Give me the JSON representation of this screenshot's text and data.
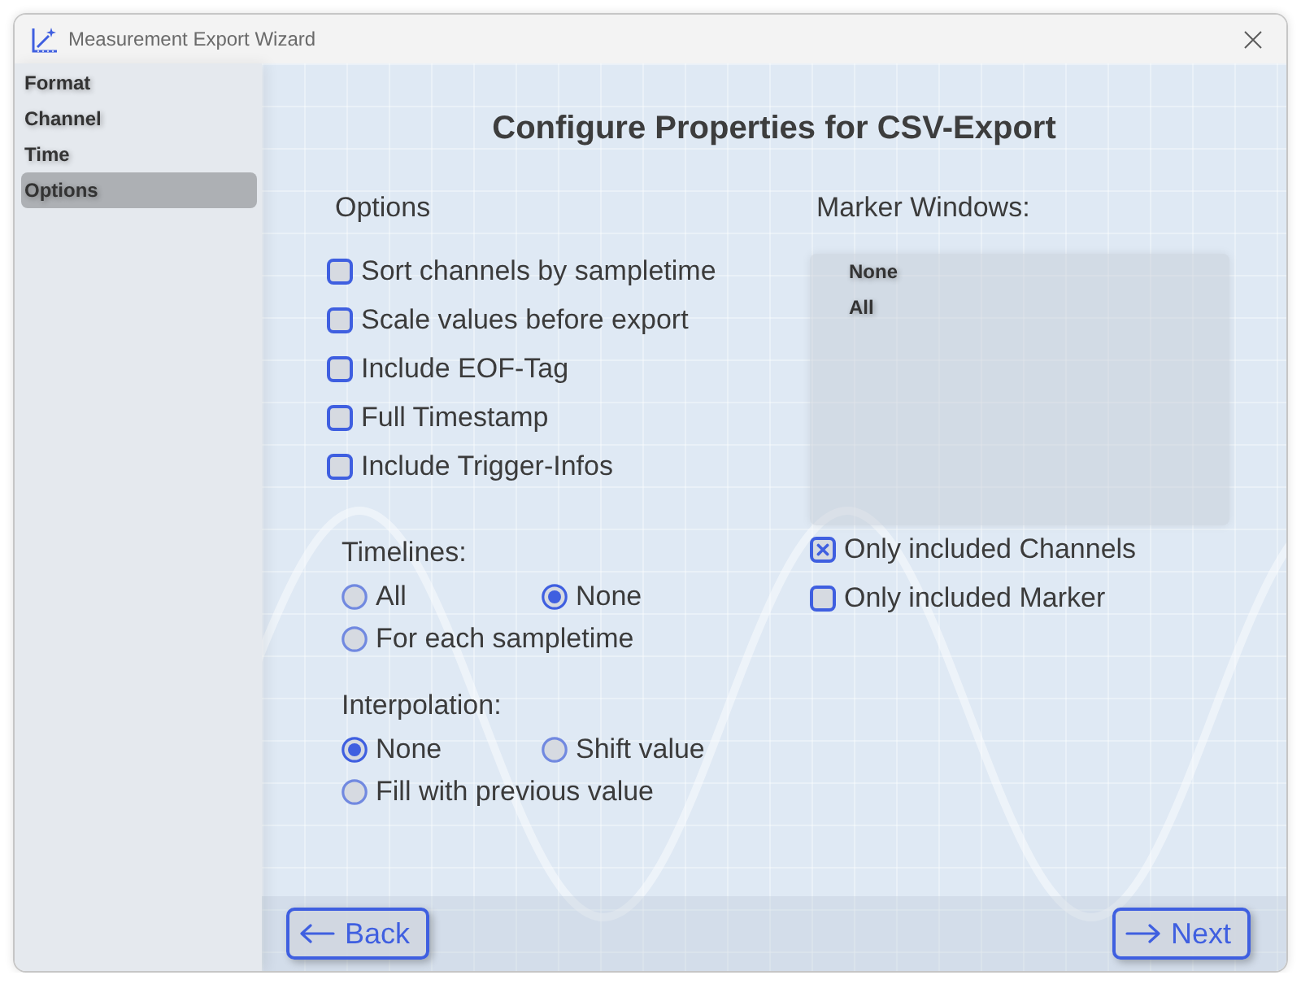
{
  "window": {
    "title": "Measurement Export Wizard"
  },
  "sidebar": {
    "items": [
      {
        "label": "Format",
        "selected": false
      },
      {
        "label": "Channel",
        "selected": false
      },
      {
        "label": "Time",
        "selected": false
      },
      {
        "label": "Options",
        "selected": true
      }
    ]
  },
  "page": {
    "heading": "Configure Properties for CSV-Export"
  },
  "options": {
    "label": "Options",
    "checkboxes": [
      {
        "label": "Sort channels by sampletime",
        "checked": false
      },
      {
        "label": "Scale values before export",
        "checked": false
      },
      {
        "label": "Include EOF-Tag",
        "checked": false
      },
      {
        "label": "Full Timestamp",
        "checked": false
      },
      {
        "label": "Include Trigger-Infos",
        "checked": false
      }
    ]
  },
  "timelines": {
    "label": "Timelines:",
    "radios": [
      {
        "label": "All",
        "selected": false
      },
      {
        "label": "None",
        "selected": true
      },
      {
        "label": "For each sampletime",
        "selected": false
      }
    ]
  },
  "interpolation": {
    "label": "Interpolation:",
    "radios": [
      {
        "label": "None",
        "selected": true
      },
      {
        "label": "Shift value",
        "selected": false
      },
      {
        "label": "Fill with previous value",
        "selected": false
      }
    ]
  },
  "marker_windows": {
    "label": "Marker Windows:",
    "items": [
      {
        "label": "None",
        "selected": false
      },
      {
        "label": "All",
        "selected": false
      }
    ],
    "checkboxes": [
      {
        "label": "Only included Channels",
        "checked": true
      },
      {
        "label": "Only included Marker",
        "checked": false
      }
    ]
  },
  "footer": {
    "buttons": [
      {
        "label": "Back",
        "kind": "back"
      },
      {
        "label": "Next",
        "kind": "next"
      }
    ]
  }
}
